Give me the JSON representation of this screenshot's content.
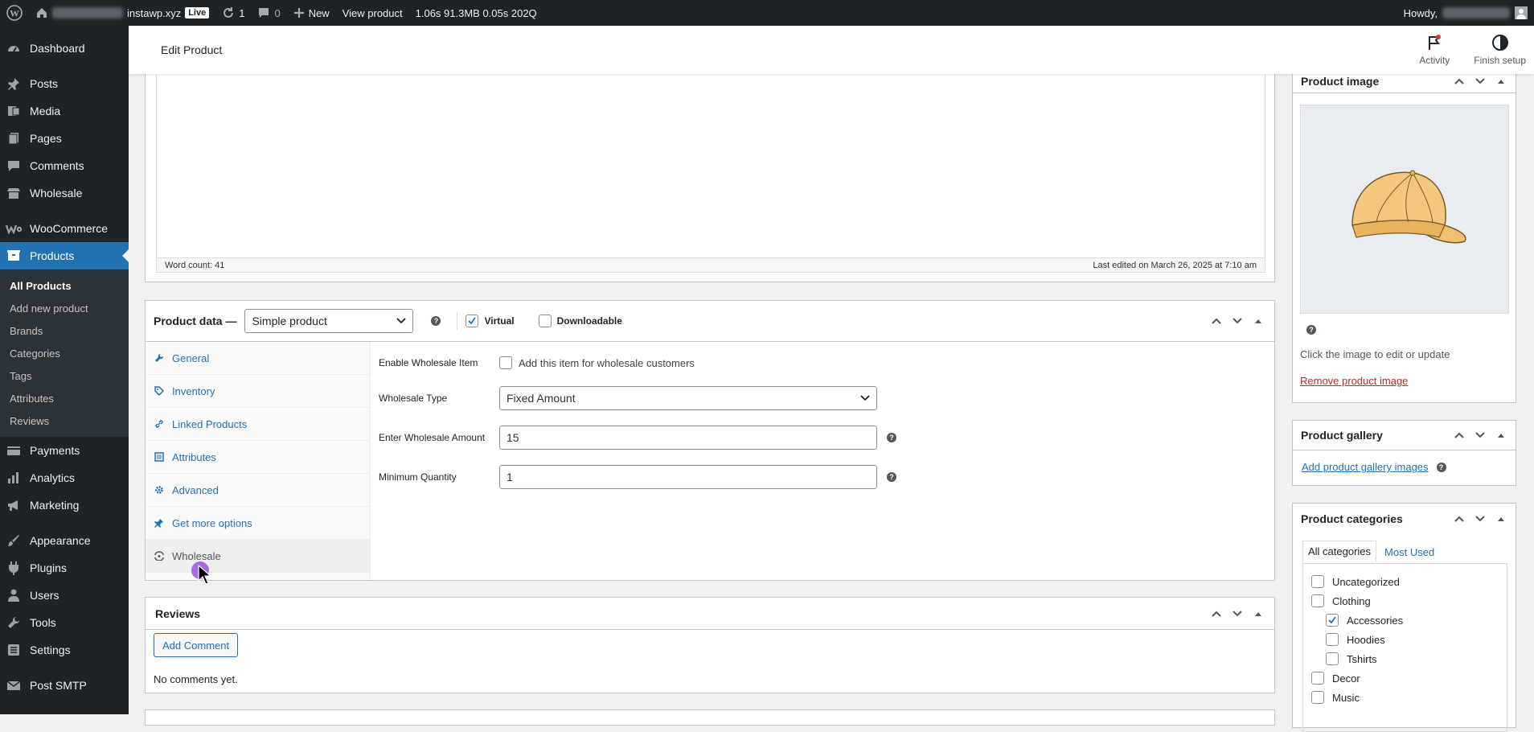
{
  "adminbar": {
    "site": "instawp.xyz",
    "live": "Live",
    "updates": "1",
    "comments": "0",
    "new": "New",
    "view": "View product",
    "stats": "1.06s 91.3MB 0.05s 202Q",
    "howdy": "Howdy,"
  },
  "sidebar": {
    "items": [
      {
        "label": "Dashboard",
        "icon": "dashboard-icon"
      },
      {
        "label": "Posts",
        "icon": "pin-icon"
      },
      {
        "label": "Media",
        "icon": "media-icon"
      },
      {
        "label": "Pages",
        "icon": "pages-icon"
      },
      {
        "label": "Comments",
        "icon": "comments-icon"
      },
      {
        "label": "Wholesale",
        "icon": "store-icon"
      },
      {
        "label": "WooCommerce",
        "icon": "woo-icon"
      },
      {
        "label": "Products",
        "icon": "products-icon"
      },
      {
        "label": "Payments",
        "icon": "payments-icon"
      },
      {
        "label": "Analytics",
        "icon": "analytics-icon"
      },
      {
        "label": "Marketing",
        "icon": "megaphone-icon"
      },
      {
        "label": "Appearance",
        "icon": "brush-icon"
      },
      {
        "label": "Plugins",
        "icon": "plugin-icon"
      },
      {
        "label": "Users",
        "icon": "users-icon"
      },
      {
        "label": "Tools",
        "icon": "wrench-icon"
      },
      {
        "label": "Settings",
        "icon": "settings-icon"
      },
      {
        "label": "Post SMTP",
        "icon": "mail-icon"
      }
    ],
    "submenu": [
      "All Products",
      "Add new product",
      "Brands",
      "Categories",
      "Tags",
      "Attributes",
      "Reviews"
    ]
  },
  "header": {
    "title": "Edit Product",
    "activity": "Activity",
    "finish_setup": "Finish setup"
  },
  "editor": {
    "word_count": "Word count: 41",
    "last_edited": "Last edited on March 26, 2025 at 7:10 am"
  },
  "product_data": {
    "title": "Product data —",
    "type": "Simple product",
    "virtual": "Virtual",
    "downloadable": "Downloadable",
    "tabs": [
      "General",
      "Inventory",
      "Linked Products",
      "Attributes",
      "Advanced",
      "Get more options",
      "Wholesale"
    ],
    "fields": {
      "enable_label": "Enable Wholesale Item",
      "enable_text": "Add this item for wholesale customers",
      "type_label": "Wholesale Type",
      "type_value": "Fixed Amount",
      "amount_label": "Enter Wholesale Amount",
      "amount_value": "15",
      "minqty_label": "Minimum Quantity",
      "minqty_value": "1"
    }
  },
  "reviews": {
    "title": "Reviews",
    "add": "Add Comment",
    "empty": "No comments yet."
  },
  "product_image": {
    "title": "Product image",
    "hint": "Click the image to edit or update",
    "remove": "Remove product image"
  },
  "gallery": {
    "title": "Product gallery",
    "add": "Add product gallery images"
  },
  "categories": {
    "title": "Product categories",
    "tab_all": "All categories",
    "tab_used": "Most Used",
    "items": [
      {
        "label": "Uncategorized",
        "checked": false,
        "child": false
      },
      {
        "label": "Clothing",
        "checked": false,
        "child": false
      },
      {
        "label": "Accessories",
        "checked": true,
        "child": true
      },
      {
        "label": "Hoodies",
        "checked": false,
        "child": true
      },
      {
        "label": "Tshirts",
        "checked": false,
        "child": true
      },
      {
        "label": "Decor",
        "checked": false,
        "child": false
      },
      {
        "label": "Music",
        "checked": false,
        "child": false
      }
    ]
  }
}
